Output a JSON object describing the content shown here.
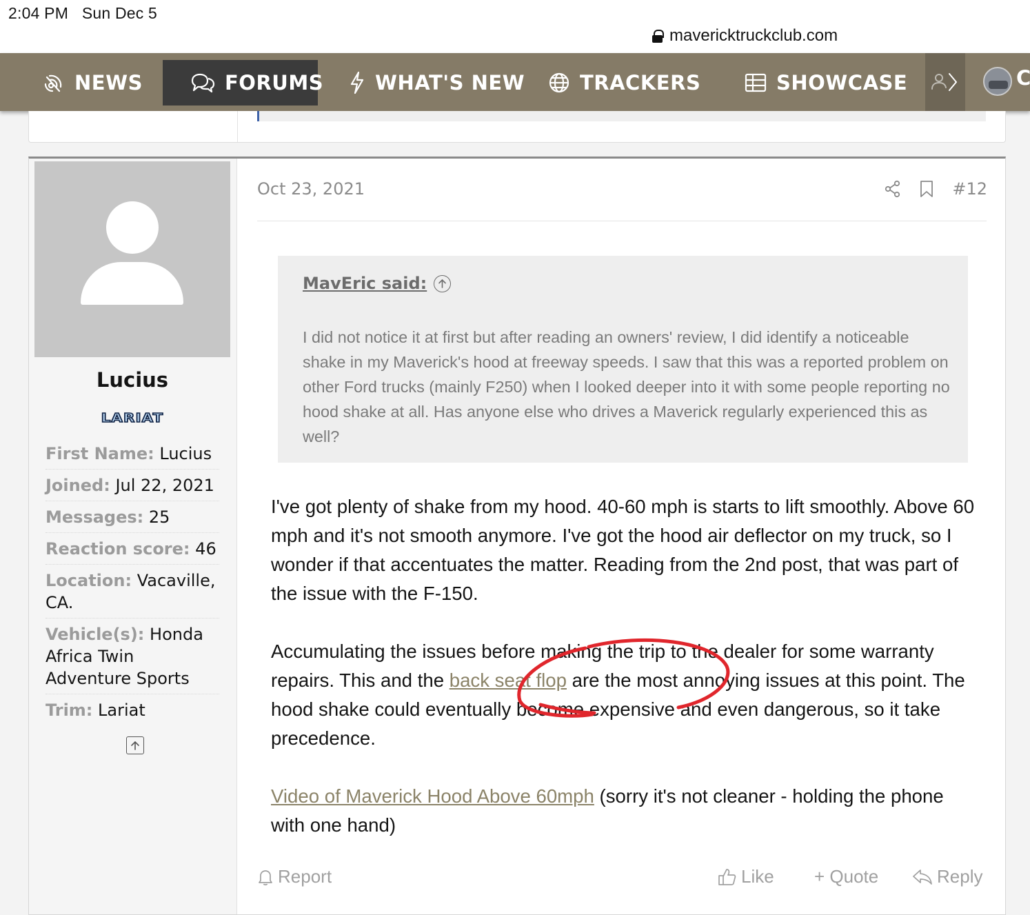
{
  "status_bar": {
    "time": "2:04 PM",
    "date": "Sun Dec 5",
    "url": "mavericktruckclub.com"
  },
  "nav": {
    "items": [
      {
        "label": "NEWS",
        "icon": "broadcast-icon"
      },
      {
        "label": "FORUMS",
        "icon": "chat-bubbles-icon",
        "active": true
      },
      {
        "label": "WHAT'S NEW",
        "icon": "bolt-icon"
      },
      {
        "label": "TRACKERS",
        "icon": "globe-icon"
      },
      {
        "label": "SHOWCASE",
        "icon": "grid-icon"
      }
    ],
    "more_icon": "members-arrow-icon",
    "overflow_label": "C"
  },
  "post": {
    "author": {
      "name": "Lucius",
      "badge": "LARIAT",
      "fields": [
        {
          "key": "First Name:",
          "value": "Lucius"
        },
        {
          "key": "Joined:",
          "value": "Jul 22, 2021"
        },
        {
          "key": "Messages:",
          "value": "25"
        },
        {
          "key": "Reaction score:",
          "value": "46"
        },
        {
          "key": "Location:",
          "value": "Vacaville, CA."
        },
        {
          "key": "Vehicle(s):",
          "value": "Honda Africa Twin Adventure Sports"
        },
        {
          "key": "Trim:",
          "value": "Lariat"
        }
      ]
    },
    "date": "Oct 23, 2021",
    "number": "#12",
    "quote": {
      "author": "MavEric said:",
      "text": "I did not notice it at first but after reading an owners' review, I did identify a noticeable shake in my Maverick's hood at freeway speeds. I saw that this was a reported problem on other Ford trucks (mainly F250) when I looked deeper into it with some people reporting no hood shake at all. Has anyone else who drives a Maverick regularly experienced this as well?"
    },
    "paragraph1": "I've got plenty of shake from my hood. 40-60 mph is starts to lift smoothly. Above 60 mph and it's not smooth anymore. I've got the hood air deflector on my truck, so I wonder if that accentuates the matter. Reading from the 2nd post, that was part of the issue with the F-150.",
    "paragraph2": {
      "before": "Accumulating the issues before making the trip to the dealer for some warranty repairs. This and the ",
      "link": "back seat flop",
      "after": " are the most annoying issues at this point. The hood shake could eventually become expensive and even dangerous, so it take precedence."
    },
    "paragraph3": {
      "link": "Video of Maverick Hood Above 60mph",
      "after": " (sorry it's not cleaner - holding the phone with one hand)"
    },
    "actions": {
      "report": "Report",
      "like": "Like",
      "quote": "+ Quote",
      "reply": "Reply"
    }
  },
  "colors": {
    "nav_bg": "#857b67",
    "nav_active": "#3b3b3b",
    "link": "#8b8368",
    "annotation": "#e0262c"
  }
}
